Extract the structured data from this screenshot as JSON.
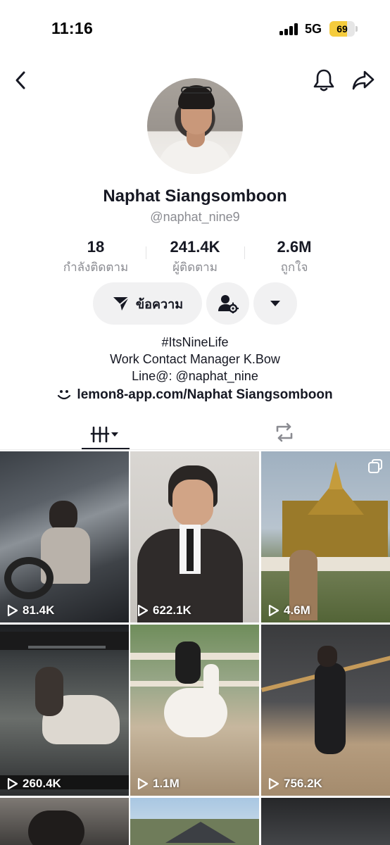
{
  "status_bar": {
    "time": "11:16",
    "network": "5G",
    "battery_level": 69,
    "battery_label": "69"
  },
  "nav": {
    "back_icon": "chevron-left-icon",
    "bell_icon": "bell-icon",
    "share_icon": "share-arrow-icon"
  },
  "profile": {
    "display_name": "Naphat Siangsomboon",
    "username": "@naphat_nine9",
    "stats": [
      {
        "value": "18",
        "label": "กำลังติดตาม"
      },
      {
        "value": "241.4K",
        "label": "ผู้ติดตาม"
      },
      {
        "value": "2.6M",
        "label": "ถูกใจ"
      }
    ],
    "message_button": "ข้อความ",
    "bio": [
      "#ItsNineLife",
      "Work Contact Manager K.Bow",
      "Line@: @naphat_nine"
    ],
    "link": "lemon8-app.com/Naphat Siangsomboon"
  },
  "tabs": {
    "videos_icon": "grid-icon",
    "repost_icon": "repost-icon"
  },
  "videos": [
    {
      "views": "81.4K"
    },
    {
      "views": "622.1K"
    },
    {
      "views": "4.6M",
      "multi_image": true
    },
    {
      "views": "260.4K"
    },
    {
      "views": "1.1M"
    },
    {
      "views": "756.2K"
    }
  ],
  "colors": {
    "text_primary": "#161823",
    "text_secondary": "#8a8b91",
    "button_bg": "#f1f1f2",
    "battery_yellow": "#f5cc3d"
  }
}
